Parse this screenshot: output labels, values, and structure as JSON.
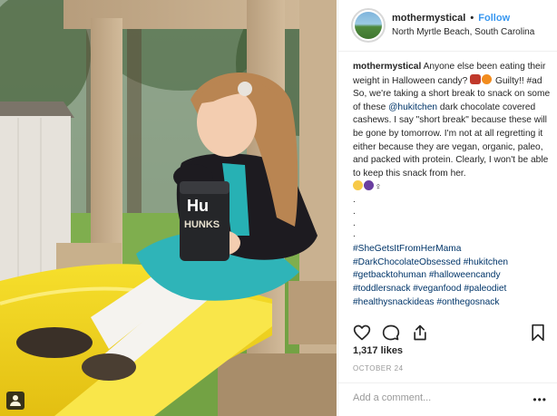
{
  "post": {
    "username": "mothermystical",
    "separator": "•",
    "follow_label": "Follow",
    "location": "North Myrtle Beach, South Carolina",
    "caption": {
      "username": "mothermystical",
      "text_1": " Anyone else been eating their weight in Halloween candy? ",
      "text_2": " Guilty!! #ad So, we're taking a short break to snack on some of these ",
      "mention": "@hukitchen",
      "text_3": " dark chocolate covered cashews. I say \"short break\" because these will be gone by tomorrow. I'm not at all regretting it either because they are vegan, organic, paleo, and packed with protein. Clearly, I won't be able to keep this snack from her. ",
      "female_sign": "♀",
      "dots": [
        ".",
        ".",
        ".",
        "."
      ],
      "hashtags": "#SheGetsItFromHerMama #DarkChocolateObsessed #hukitchen #getbacktohuman #halloweencandy #toddlersnack #veganfood #paleodiet #healthysnackideas #onthegosnack"
    },
    "likes": "1,317 likes",
    "date": "OCTOBER 24",
    "comment_placeholder": "Add a comment...",
    "more_icon": "•••",
    "bag_brand": "Hu",
    "bag_text": "HUNKS"
  },
  "icons": {
    "heart": "heart-icon",
    "comment": "comment-icon",
    "share": "share-icon",
    "bookmark": "bookmark-icon",
    "candy": "candy-emoji",
    "pumpkin": "pumpkin-emoji",
    "laugh": "laughing-emoji",
    "woman": "woman-emoji",
    "user_tag": "user-tag-icon"
  },
  "colors": {
    "link_blue": "#3897f0",
    "mention_blue": "#003569",
    "meta_gray": "#999999",
    "border": "#efefef"
  }
}
